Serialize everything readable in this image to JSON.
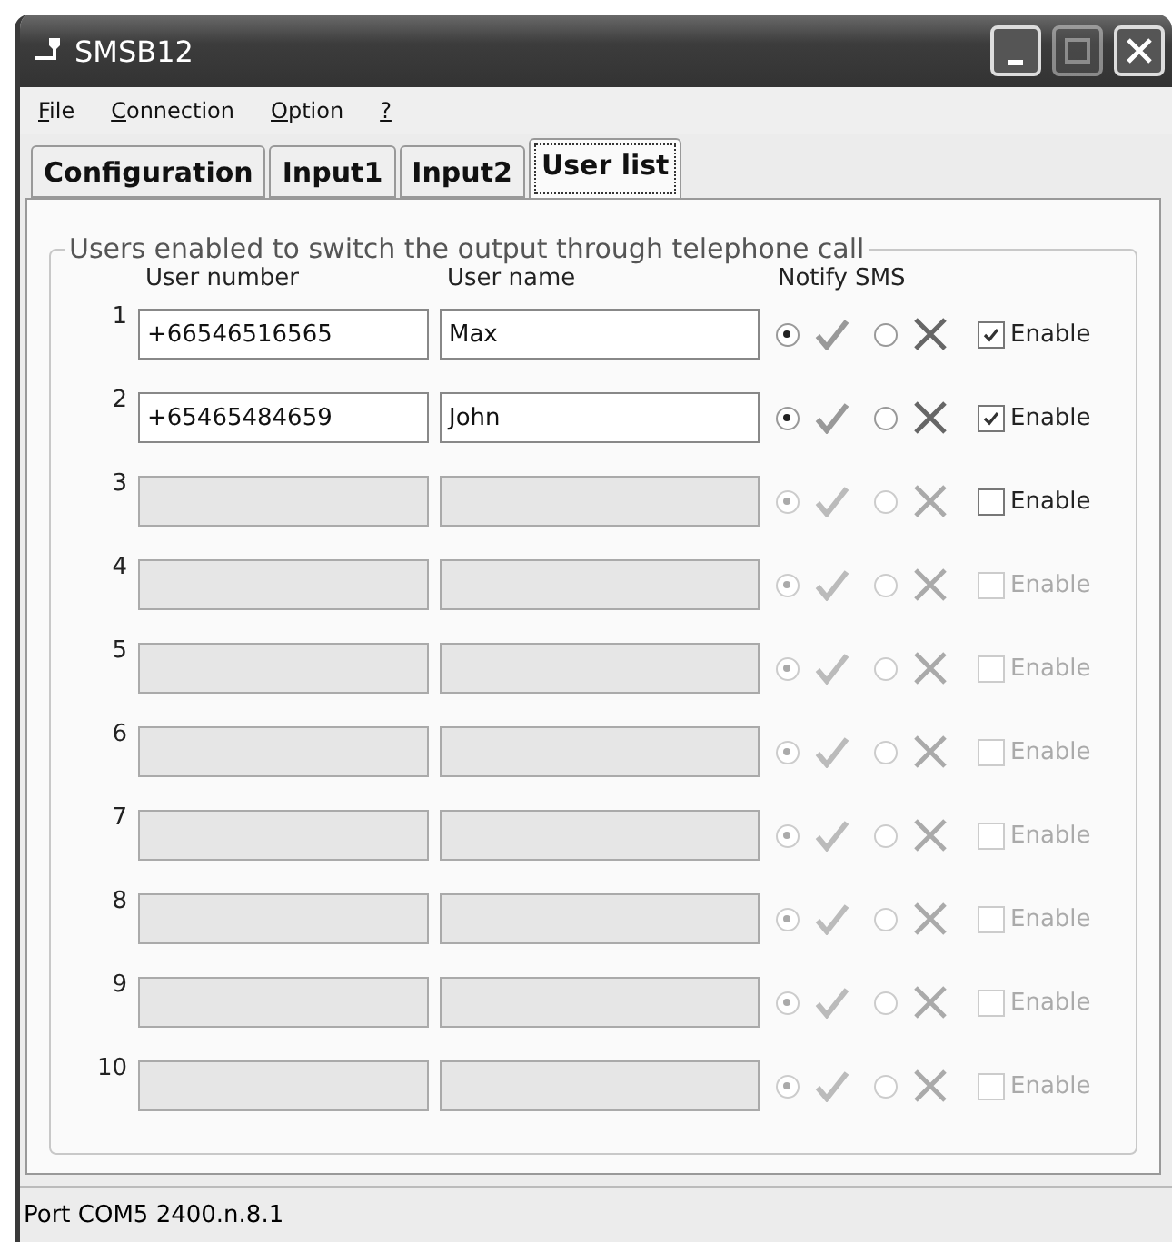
{
  "window": {
    "title": "SMSB12"
  },
  "menu": [
    {
      "label": "File"
    },
    {
      "label": "Connection"
    },
    {
      "label": "Option"
    },
    {
      "label": "?"
    }
  ],
  "tabs": [
    {
      "label": "Configuration",
      "selected": false
    },
    {
      "label": "Input1",
      "selected": false
    },
    {
      "label": "Input2",
      "selected": false
    },
    {
      "label": "User list",
      "selected": true
    }
  ],
  "group": {
    "title": "Users enabled to switch the output through telephone call",
    "headers": [
      "User number",
      "User name",
      "Notify SMS"
    ]
  },
  "rows": [
    {
      "index": "1",
      "user_number": "+66546516565",
      "user_name": "Max",
      "fields_disabled": false,
      "notify_on_selected": true,
      "enable": {
        "label": "Enable",
        "checked": true,
        "disabled": false
      }
    },
    {
      "index": "2",
      "user_number": "+65465484659",
      "user_name": "John",
      "fields_disabled": false,
      "notify_on_selected": true,
      "enable": {
        "label": "Enable",
        "checked": true,
        "disabled": false
      }
    },
    {
      "index": "3",
      "fields_disabled": true,
      "notify_on_selected": true,
      "enable": {
        "label": "Enable",
        "checked": false,
        "disabled": false
      }
    },
    {
      "index": "4",
      "fields_disabled": true,
      "notify_on_selected": true,
      "enable": {
        "label": "Enable",
        "checked": false,
        "disabled": true
      }
    },
    {
      "index": "5",
      "fields_disabled": true,
      "notify_on_selected": true,
      "enable": {
        "label": "Enable",
        "checked": false,
        "disabled": true
      }
    },
    {
      "index": "6",
      "fields_disabled": true,
      "notify_on_selected": true,
      "enable": {
        "label": "Enable",
        "checked": false,
        "disabled": true
      }
    },
    {
      "index": "7",
      "fields_disabled": true,
      "notify_on_selected": true,
      "enable": {
        "label": "Enable",
        "checked": false,
        "disabled": true
      }
    },
    {
      "index": "8",
      "fields_disabled": true,
      "notify_on_selected": true,
      "enable": {
        "label": "Enable",
        "checked": false,
        "disabled": true
      }
    },
    {
      "index": "9",
      "fields_disabled": true,
      "notify_on_selected": true,
      "enable": {
        "label": "Enable",
        "checked": false,
        "disabled": true
      }
    },
    {
      "index": "10",
      "fields_disabled": true,
      "notify_on_selected": true,
      "enable": {
        "label": "Enable",
        "checked": false,
        "disabled": true
      }
    }
  ],
  "status_bar": "Port COM5 2400.n.8.1"
}
